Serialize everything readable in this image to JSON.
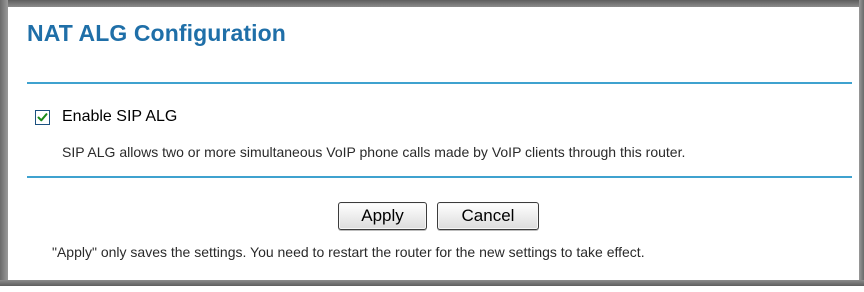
{
  "page": {
    "title": "NAT ALG Configuration"
  },
  "sip_alg": {
    "checkbox_label": "Enable SIP ALG",
    "checked": true,
    "description": "SIP ALG allows two or more simultaneous VoIP phone calls made by VoIP clients through this router."
  },
  "actions": {
    "apply_label": "Apply",
    "cancel_label": "Cancel"
  },
  "footer": {
    "note": "\"Apply\" only saves the settings. You need to restart the router for the new settings to take effect."
  },
  "colors": {
    "title": "#1f6fa8",
    "rule": "#3fa2cf",
    "frame": "#7a7a7a"
  },
  "icons": {
    "checkbox_mark": "checkmark-icon"
  }
}
